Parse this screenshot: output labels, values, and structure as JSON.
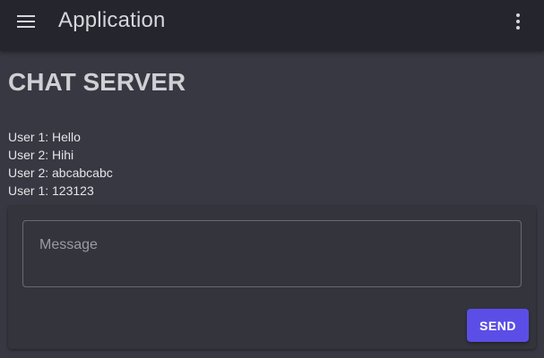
{
  "app_bar": {
    "title": "Application",
    "menu_icon": "menu-icon",
    "more_icon": "more-vertical-icon"
  },
  "page": {
    "title": "CHAT SERVER"
  },
  "messages": [
    "User 1: Hello",
    "User 2: Hihi",
    "User 2: abcabcabc",
    "User 1: 123123"
  ],
  "composer": {
    "message_placeholder": "Message",
    "message_value": "",
    "send_label": "SEND"
  },
  "colors": {
    "app_bar": "#25252d",
    "background": "#383842",
    "accent": "#5b4ee6"
  }
}
